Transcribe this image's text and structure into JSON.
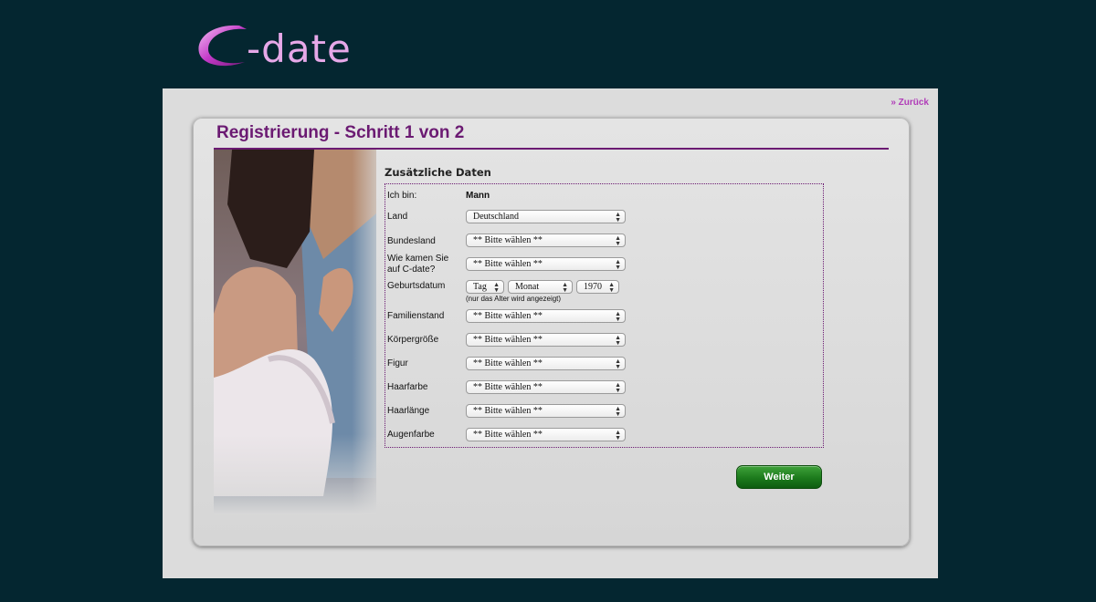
{
  "brand": {
    "name": "-date",
    "accent": "#b03cb8",
    "title_color": "#6b1a72"
  },
  "header": {
    "back_link": "» Zurück"
  },
  "page": {
    "title": "Registrierung - Schritt 1 von 2"
  },
  "form": {
    "section_title": "Zusätzliche Daten",
    "gender": {
      "label": "Ich bin:",
      "value": "Mann"
    },
    "fields": [
      {
        "label": "Land",
        "value": "Deutschland"
      },
      {
        "label": "Bundesland",
        "value": "** Bitte wählen **"
      },
      {
        "label": "Wie kamen Sie auf C-date?",
        "value": "** Bitte wählen **"
      },
      {
        "label": "Familienstand",
        "value": "** Bitte wählen **"
      },
      {
        "label": "Körpergröße",
        "value": "** Bitte wählen **"
      },
      {
        "label": "Figur",
        "value": "** Bitte wählen **"
      },
      {
        "label": "Haarfarbe",
        "value": "** Bitte wählen **"
      },
      {
        "label": "Haarlänge",
        "value": "** Bitte wählen **"
      },
      {
        "label": "Augenfarbe",
        "value": "** Bitte wählen **"
      }
    ],
    "birthdate": {
      "label": "Geburtsdatum",
      "day": "Tag",
      "month": "Monat",
      "year": "1970",
      "hint": "(nur das Alter wird angezeigt)"
    },
    "submit_label": "Weiter"
  },
  "icons": {
    "select_arrows": "updown-chevron-icon"
  }
}
